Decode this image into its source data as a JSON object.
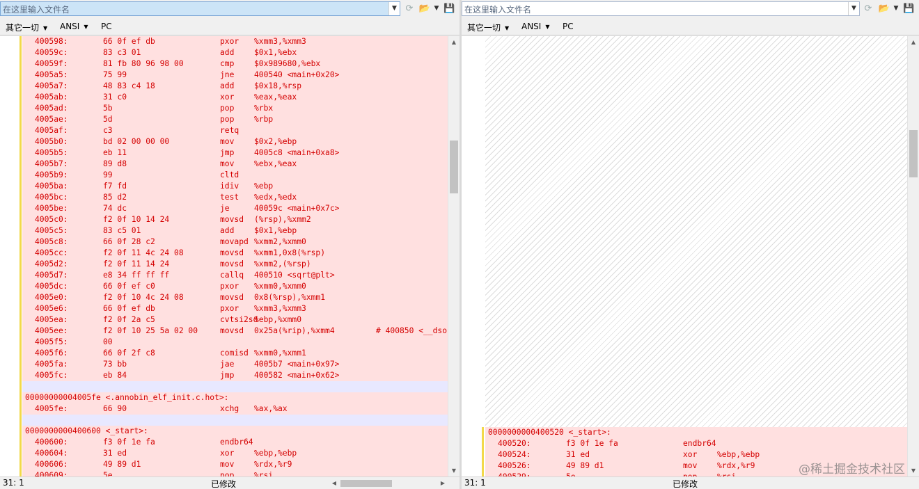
{
  "colors": {
    "diff_text": "#d40000",
    "diff_bg": "#ffe0e0",
    "blank_bg": "#e8e8ff",
    "gutter_marker": "#f2d94a"
  },
  "left": {
    "filebox_placeholder": "在这里输入文件名",
    "encoding": [
      "其它一切",
      "ANSI",
      "PC"
    ],
    "status_position": "31: 1",
    "status_modified": "已修改",
    "lines": [
      {
        "a": "400598:",
        "b": "66 0f ef db",
        "m": "pxor",
        "o": "%xmm3,%xmm3"
      },
      {
        "a": "40059c:",
        "b": "83 c3 01",
        "m": "add",
        "o": "$0x1,%ebx"
      },
      {
        "a": "40059f:",
        "b": "81 fb 80 96 98 00",
        "m": "cmp",
        "o": "$0x989680,%ebx"
      },
      {
        "a": "4005a5:",
        "b": "75 99",
        "m": "jne",
        "o": "400540 <main+0x20>"
      },
      {
        "a": "4005a7:",
        "b": "48 83 c4 18",
        "m": "add",
        "o": "$0x18,%rsp"
      },
      {
        "a": "4005ab:",
        "b": "31 c0",
        "m": "xor",
        "o": "%eax,%eax"
      },
      {
        "a": "4005ad:",
        "b": "5b",
        "m": "pop",
        "o": "%rbx"
      },
      {
        "a": "4005ae:",
        "b": "5d",
        "m": "pop",
        "o": "%rbp"
      },
      {
        "a": "4005af:",
        "b": "c3",
        "m": "retq",
        "o": ""
      },
      {
        "a": "4005b0:",
        "b": "bd 02 00 00 00",
        "m": "mov",
        "o": "$0x2,%ebp"
      },
      {
        "a": "4005b5:",
        "b": "eb 11",
        "m": "jmp",
        "o": "4005c8 <main+0xa8>"
      },
      {
        "a": "4005b7:",
        "b": "89 d8",
        "m": "mov",
        "o": "%ebx,%eax"
      },
      {
        "a": "4005b9:",
        "b": "99",
        "m": "cltd",
        "o": ""
      },
      {
        "a": "4005ba:",
        "b": "f7 fd",
        "m": "idiv",
        "o": "%ebp"
      },
      {
        "a": "4005bc:",
        "b": "85 d2",
        "m": "test",
        "o": "%edx,%edx"
      },
      {
        "a": "4005be:",
        "b": "74 dc",
        "m": "je",
        "o": "40059c <main+0x7c>"
      },
      {
        "a": "4005c0:",
        "b": "f2 0f 10 14 24",
        "m": "movsd",
        "o": "(%rsp),%xmm2"
      },
      {
        "a": "4005c5:",
        "b": "83 c5 01",
        "m": "add",
        "o": "$0x1,%ebp"
      },
      {
        "a": "4005c8:",
        "b": "66 0f 28 c2",
        "m": "movapd",
        "o": "%xmm2,%xmm0"
      },
      {
        "a": "4005cc:",
        "b": "f2 0f 11 4c 24 08",
        "m": "movsd",
        "o": "%xmm1,0x8(%rsp)"
      },
      {
        "a": "4005d2:",
        "b": "f2 0f 11 14 24",
        "m": "movsd",
        "o": "%xmm2,(%rsp)"
      },
      {
        "a": "4005d7:",
        "b": "e8 34 ff ff ff",
        "m": "callq",
        "o": "400510 <sqrt@plt>"
      },
      {
        "a": "4005dc:",
        "b": "66 0f ef c0",
        "m": "pxor",
        "o": "%xmm0,%xmm0"
      },
      {
        "a": "4005e0:",
        "b": "f2 0f 10 4c 24 08",
        "m": "movsd",
        "o": "0x8(%rsp),%xmm1"
      },
      {
        "a": "4005e6:",
        "b": "66 0f ef db",
        "m": "pxor",
        "o": "%xmm3,%xmm3"
      },
      {
        "a": "4005ea:",
        "b": "f2 0f 2a c5",
        "m": "cvtsi2sd",
        "o": "%ebp,%xmm0"
      },
      {
        "a": "4005ee:",
        "b": "f2 0f 10 25 5a 02 00",
        "m": "movsd",
        "o": "0x25a(%rip),%xmm4",
        "c": "# 400850 <__dso"
      },
      {
        "a": "4005f5:",
        "b": "00",
        "m": "",
        "o": ""
      },
      {
        "a": "4005f6:",
        "b": "66 0f 2f c8",
        "m": "comisd",
        "o": "%xmm0,%xmm1"
      },
      {
        "a": "4005fa:",
        "b": "73 bb",
        "m": "jae",
        "o": "4005b7 <main+0x97>"
      },
      {
        "a": "4005fc:",
        "b": "eb 84",
        "m": "jmp",
        "o": "400582 <main+0x62>"
      },
      {
        "blank": true
      },
      {
        "label": "00000000004005fe <.annobin_elf_init.c.hot>:"
      },
      {
        "a": "4005fe:",
        "b": "66 90",
        "m": "xchg",
        "o": "%ax,%ax"
      },
      {
        "blank": true
      },
      {
        "label": "0000000000400600 <_start>:"
      },
      {
        "a": "400600:",
        "b": "f3 0f 1e fa",
        "m": "endbr64",
        "o": ""
      },
      {
        "a": "400604:",
        "b": "31 ed",
        "m": "xor",
        "o": "%ebp,%ebp"
      },
      {
        "a": "400606:",
        "b": "49 89 d1",
        "m": "mov",
        "o": "%rdx,%r9"
      },
      {
        "a": "400609:",
        "b": "5e",
        "m": "pop",
        "o": "%rsi"
      }
    ]
  },
  "right": {
    "filebox_placeholder": "在这里输入文件名",
    "encoding": [
      "其它一切",
      "ANSI",
      "PC"
    ],
    "status_position": "31: 1",
    "status_modified": "已修改",
    "lines": [
      {
        "label": "0000000000400520 <_start>:"
      },
      {
        "a": "400520:",
        "b": "f3 0f 1e fa",
        "m": "endbr64",
        "o": ""
      },
      {
        "a": "400524:",
        "b": "31 ed",
        "m": "xor",
        "o": "%ebp,%ebp"
      },
      {
        "a": "400526:",
        "b": "49 89 d1",
        "m": "mov",
        "o": "%rdx,%r9"
      },
      {
        "a": "400529:",
        "b": "5e",
        "m": "pop",
        "o": "%rsi"
      }
    ]
  },
  "watermark": "@稀土掘金技术社区"
}
